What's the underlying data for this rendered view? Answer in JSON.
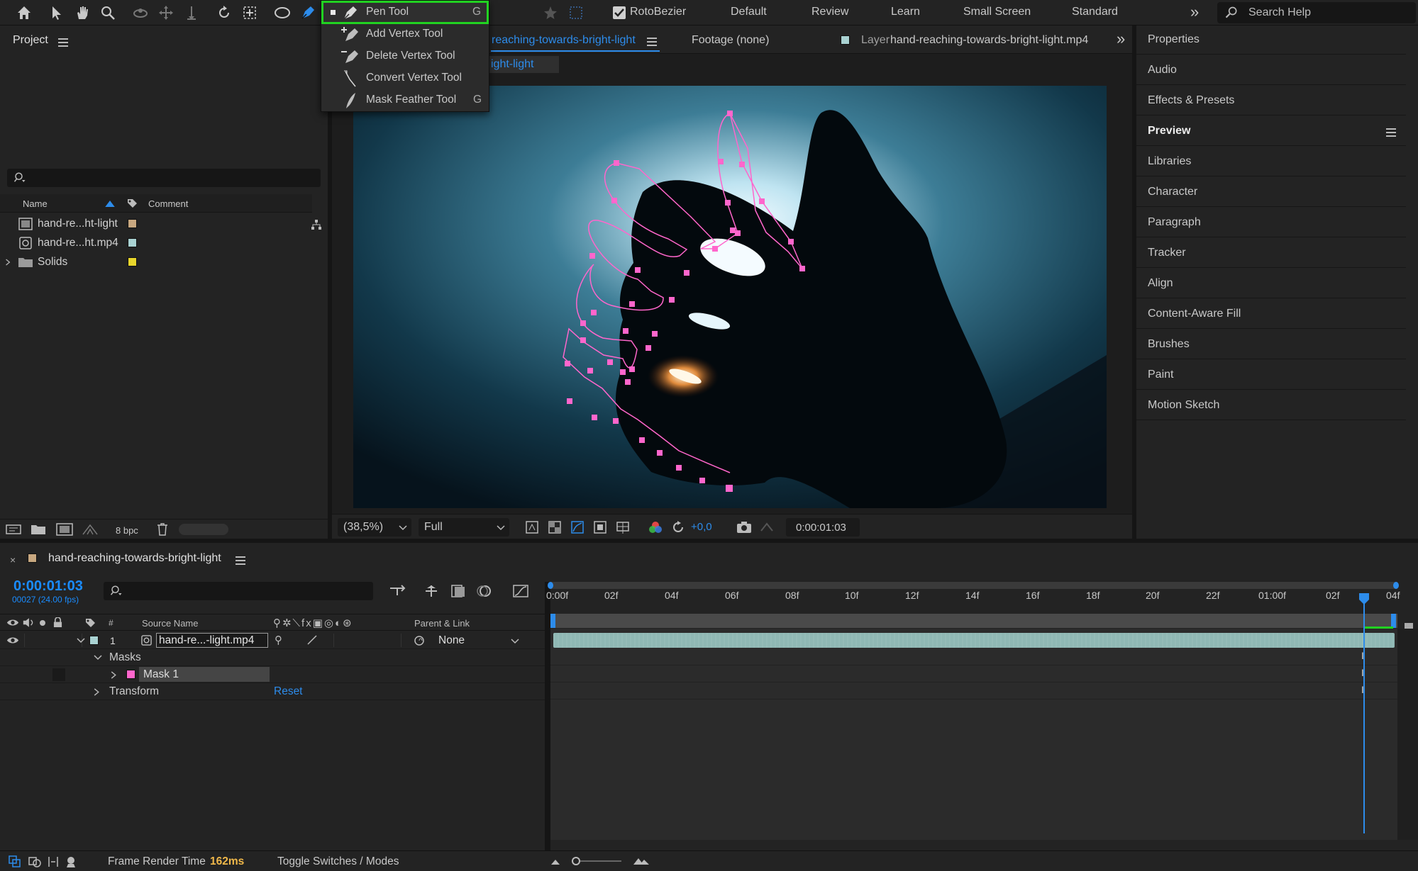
{
  "colors": {
    "accent_blue": "#2d8ceb",
    "mask_pink": "#ff66cc",
    "highlight_green": "#21d221",
    "timecode_blue": "#1a8cff",
    "clip_teal": "#8fb8b4",
    "render_time_orange": "#f0b84a"
  },
  "toolbar": {
    "icons": [
      "home-icon",
      "selection-icon",
      "hand-icon",
      "zoom-icon",
      "orbit-icon",
      "pan-icon",
      "dolly-icon",
      "rotate-icon",
      "pan-behind-icon",
      "ellipse-icon",
      "pen-icon"
    ],
    "rotobezier_label": "RotoBezier",
    "rotobezier_checked": true,
    "workspaces": [
      "Default",
      "Review",
      "Learn",
      "Small Screen",
      "Standard"
    ],
    "more": "»",
    "search_placeholder": "Search Help"
  },
  "pen_menu": {
    "items": [
      {
        "label": "Pen Tool",
        "shortcut": "G",
        "selected": true,
        "icon": "pen-icon"
      },
      {
        "label": "Add Vertex Tool",
        "shortcut": "",
        "icon": "add-vertex-icon"
      },
      {
        "label": "Delete Vertex Tool",
        "shortcut": "",
        "icon": "delete-vertex-icon"
      },
      {
        "label": "Convert Vertex Tool",
        "shortcut": "",
        "icon": "convert-vertex-icon"
      },
      {
        "label": "Mask Feather Tool",
        "shortcut": "G",
        "icon": "mask-feather-icon"
      }
    ]
  },
  "project": {
    "title": "Project",
    "search_placeholder": "",
    "columns": {
      "name": "Name",
      "comment": "Comment"
    },
    "items": [
      {
        "name": "hand-re...ht-light",
        "type": "composition",
        "color": "#c8a880"
      },
      {
        "name": "hand-re...ht.mp4",
        "type": "footage",
        "color": "#a9d2d2"
      },
      {
        "name": "Solids",
        "type": "folder",
        "color": "#e8d62c"
      }
    ],
    "bpc": "8 bpc"
  },
  "composition": {
    "tab_label": "reaching-towards-bright-light",
    "sub_tab_label": "ight-light",
    "footage_tab": "Footage (none)",
    "layer_tab_prefix": "Layer",
    "layer_tab_name": "hand-reaching-towards-bright-light.mp4",
    "zoom": "(38,5%)",
    "resolution": "Full",
    "exposure": "+0,0",
    "timecode": "0:00:01:03"
  },
  "right_panels": [
    "Properties",
    "Audio",
    "Effects & Presets",
    "Preview",
    "Libraries",
    "Character",
    "Paragraph",
    "Tracker",
    "Align",
    "Content-Aware Fill",
    "Brushes",
    "Paint",
    "Motion Sketch"
  ],
  "timeline": {
    "comp_name": "hand-reaching-towards-bright-light",
    "timecode": "0:00:01:03",
    "frame_info": "00027 (24.00 fps)",
    "search_placeholder": "",
    "columns": {
      "num": "#",
      "source": "Source Name",
      "parent": "Parent & Link"
    },
    "ruler": [
      "0:00f",
      "02f",
      "04f",
      "06f",
      "08f",
      "10f",
      "12f",
      "14f",
      "16f",
      "18f",
      "20f",
      "22f",
      "01:00f",
      "02f",
      "04f"
    ],
    "layers": [
      {
        "num": "1",
        "name": "hand-re...-light.mp4",
        "parent": "None",
        "color": "#a9d2d2"
      }
    ],
    "masks_label": "Masks",
    "mask_name": "Mask 1",
    "transform_label": "Transform",
    "reset_label": "Reset",
    "playhead_fraction": 0.94
  },
  "status": {
    "render_label": "Frame Render Time",
    "render_value": "162ms",
    "toggle_label": "Toggle Switches / Modes"
  }
}
